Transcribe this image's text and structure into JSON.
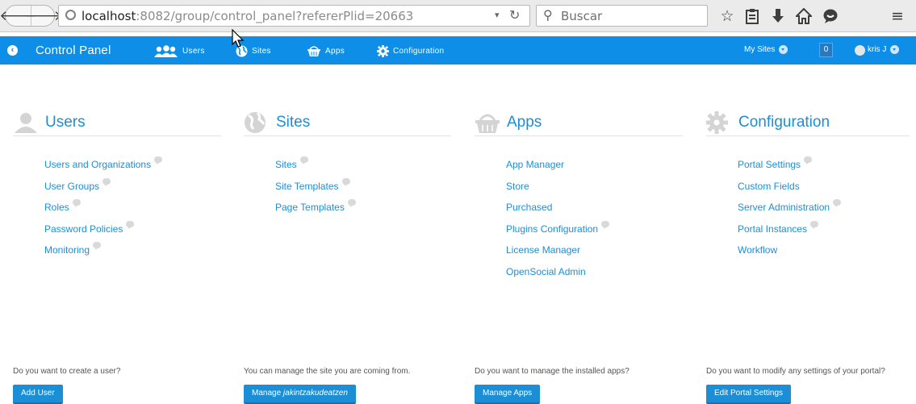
{
  "browser": {
    "url_prefix": "",
    "url_host": "localhost",
    "url_rest": ":8082/group/control_panel?refererPlid=20663",
    "search_placeholder": "Buscar"
  },
  "dockbar": {
    "title": "Control Panel",
    "items": [
      {
        "label": "Users"
      },
      {
        "label": "Sites"
      },
      {
        "label": "Apps"
      },
      {
        "label": "Configuration"
      }
    ],
    "my_sites": "My Sites",
    "notifications_count": "0",
    "user_name": "kris J"
  },
  "panels": [
    {
      "title": "Users",
      "links": [
        "Users and Organizations",
        "User Groups",
        "Roles",
        "Password Policies",
        "Monitoring"
      ],
      "question": "Do you want to create a user?",
      "button": "Add User"
    },
    {
      "title": "Sites",
      "links": [
        "Sites",
        "Site Templates",
        "Page Templates"
      ],
      "question": "You can manage the site you are coming from.",
      "button_prefix": "Manage ",
      "button_site": "jakintzakudeatzen"
    },
    {
      "title": "Apps",
      "links": [
        "App Manager",
        "Store",
        "Purchased",
        "Plugins Configuration",
        "License Manager",
        "OpenSocial Admin"
      ],
      "question": "Do you want to manage the installed apps?",
      "button": "Manage Apps"
    },
    {
      "title": "Configuration",
      "links": [
        "Portal Settings",
        "Custom Fields",
        "Server Administration",
        "Portal Instances",
        "Workflow"
      ],
      "question": "Do you want to modify any settings of your portal?",
      "button": "Edit Portal Settings"
    }
  ],
  "icons": {
    "back": "arrow-left-icon",
    "forward": "arrow-right-icon",
    "bookmark": "star-icon",
    "reading_list": "clipboard-icon",
    "downloads": "download-icon",
    "home": "home-icon",
    "chat": "chat-icon",
    "menu": "hamburger-icon"
  },
  "colors": {
    "dockbar": "#0e8ee7",
    "link": "#1b8fd8",
    "button": "#1c8ed6"
  }
}
